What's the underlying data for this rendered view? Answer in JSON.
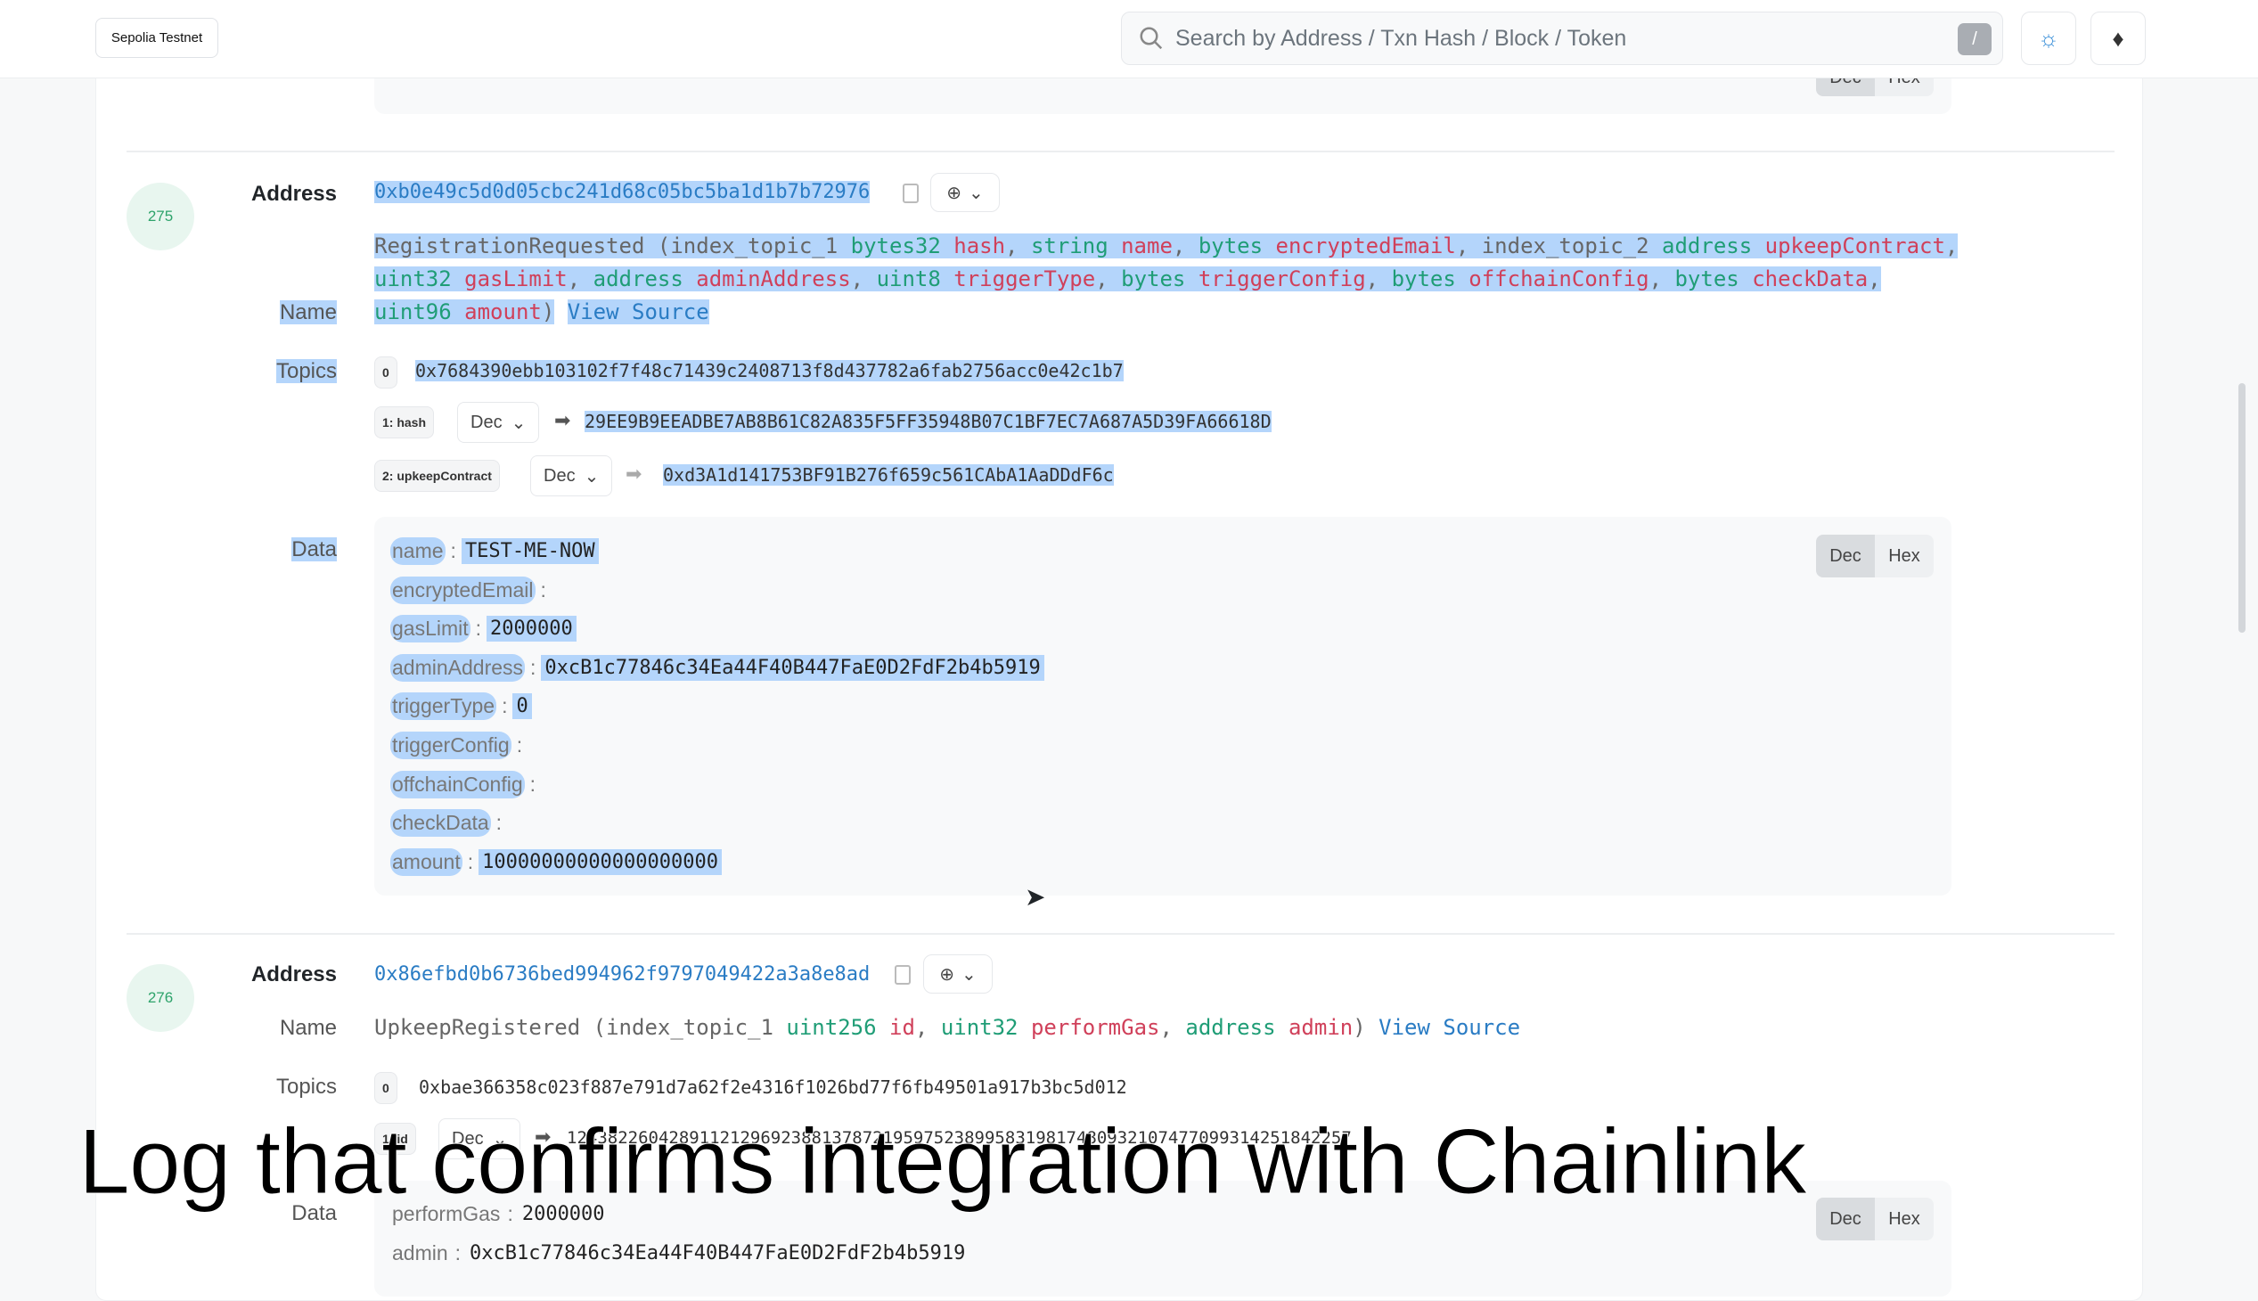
{
  "header": {
    "network": "Sepolia Testnet",
    "search_placeholder": "Search by Address / Txn Hash / Block / Token",
    "search_shortcut": "/",
    "theme_icon": "sun-icon",
    "chain_icon": "ethereum-icon"
  },
  "prev_log": {
    "dec": "Dec",
    "hex": "Hex"
  },
  "logs": [
    {
      "index": "275",
      "address_label": "Address",
      "address": "0xb0e49c5d0d05cbc241d68c05bc5ba1d1b7b72976",
      "name_label": "Name",
      "event": {
        "name": "RegistrationRequested",
        "params": [
          {
            "prefix": "index_topic_1",
            "type": "bytes32",
            "name": "hash"
          },
          {
            "type": "string",
            "name": "name"
          },
          {
            "type": "bytes",
            "name": "encryptedEmail"
          },
          {
            "prefix": "index_topic_2",
            "type": "address",
            "name": "upkeepContract"
          },
          {
            "type": "uint32",
            "name": "gasLimit"
          },
          {
            "type": "address",
            "name": "adminAddress"
          },
          {
            "type": "uint8",
            "name": "triggerType"
          },
          {
            "type": "bytes",
            "name": "triggerConfig"
          },
          {
            "type": "bytes",
            "name": "offchainConfig"
          },
          {
            "type": "bytes",
            "name": "checkData"
          },
          {
            "type": "uint96",
            "name": "amount"
          }
        ]
      },
      "view_source": "View Source",
      "topics_label": "Topics",
      "topics": [
        {
          "badge": "0",
          "value": "0x7684390ebb103102f7f48c71439c2408713f8d437782a6fab2756acc0e42c1b7"
        },
        {
          "badge": "1: hash",
          "format": "Dec",
          "value": "29EE9B9EEADBE7AB8B61C82A835F5FF35948B07C1BF7EC7A687A5D39FA66618D"
        },
        {
          "badge": "2: upkeepContract",
          "format": "Dec",
          "value": "0xd3A1d141753BF91B276f659c561CAbA1AaDDdF6c"
        }
      ],
      "data_label": "Data",
      "data": [
        {
          "key": "name",
          "value": "TEST-ME-NOW"
        },
        {
          "key": "encryptedEmail",
          "value": ""
        },
        {
          "key": "gasLimit",
          "value": "2000000"
        },
        {
          "key": "adminAddress",
          "value": "0xcB1c77846c34Ea44F40B447FaE0D2FdF2b4b5919"
        },
        {
          "key": "triggerType",
          "value": "0"
        },
        {
          "key": "triggerConfig",
          "value": ""
        },
        {
          "key": "offchainConfig",
          "value": ""
        },
        {
          "key": "checkData",
          "value": ""
        },
        {
          "key": "amount",
          "value": "10000000000000000000"
        }
      ],
      "dec": "Dec",
      "hex": "Hex"
    },
    {
      "index": "276",
      "address_label": "Address",
      "address": "0x86efbd0b6736bed994962f9797049422a3a8e8ad",
      "name_label": "Name",
      "event": {
        "name": "UpkeepRegistered",
        "params": [
          {
            "prefix": "index_topic_1",
            "type": "uint256",
            "name": "id"
          },
          {
            "type": "uint32",
            "name": "performGas"
          },
          {
            "type": "address",
            "name": "admin"
          }
        ]
      },
      "view_source": "View Source",
      "topics_label": "Topics",
      "topics": [
        {
          "badge": "0",
          "value": "0xbae366358c023f887e791d7a62f2e4316f1026bd77f6fb49501a917b3bc5d012"
        },
        {
          "badge": "1: id",
          "format": "Dec",
          "value": "12438226042891121296923881378721959752389958319817480932107477099314251842257"
        }
      ],
      "data_label": "Data",
      "data": [
        {
          "key": "performGas",
          "value": "2000000"
        },
        {
          "key": "admin",
          "value": "0xcB1c77846c34Ea44F40B447FaE0D2FdF2b4b5919"
        }
      ],
      "dec": "Dec",
      "hex": "Hex"
    }
  ],
  "caption": "Log that confirms integration with Chainlink"
}
